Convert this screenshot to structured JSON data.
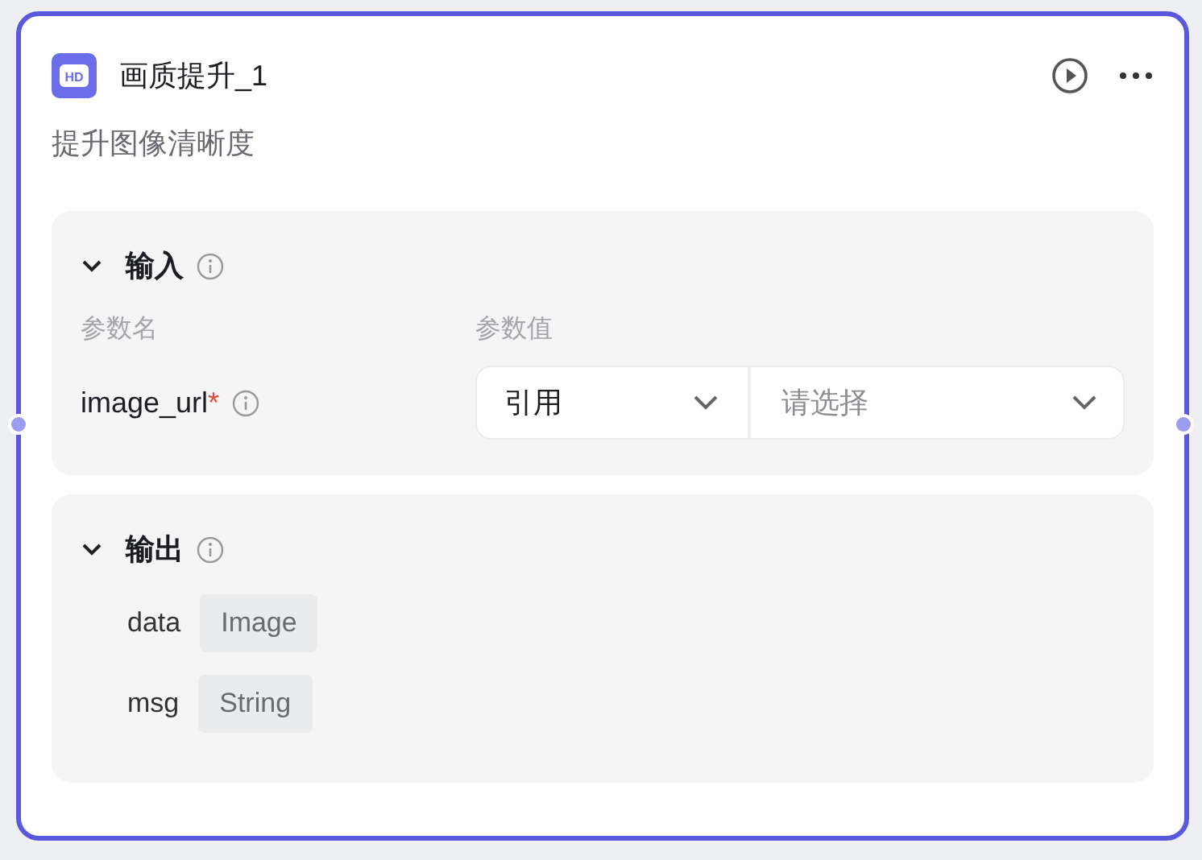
{
  "node": {
    "icon_text": "HD",
    "title": "画质提升_1",
    "description": "提升图像清晰度"
  },
  "input": {
    "title": "输入",
    "expanded": true,
    "columns": [
      "参数名",
      "参数值"
    ],
    "params": [
      {
        "name": "image_url",
        "required": true,
        "required_mark": "*",
        "mode": "引用",
        "placeholder": "请选择"
      }
    ]
  },
  "output": {
    "title": "输出",
    "expanded": true,
    "fields": [
      {
        "name": "data",
        "type": "Image"
      },
      {
        "name": "msg",
        "type": "String"
      }
    ]
  }
}
